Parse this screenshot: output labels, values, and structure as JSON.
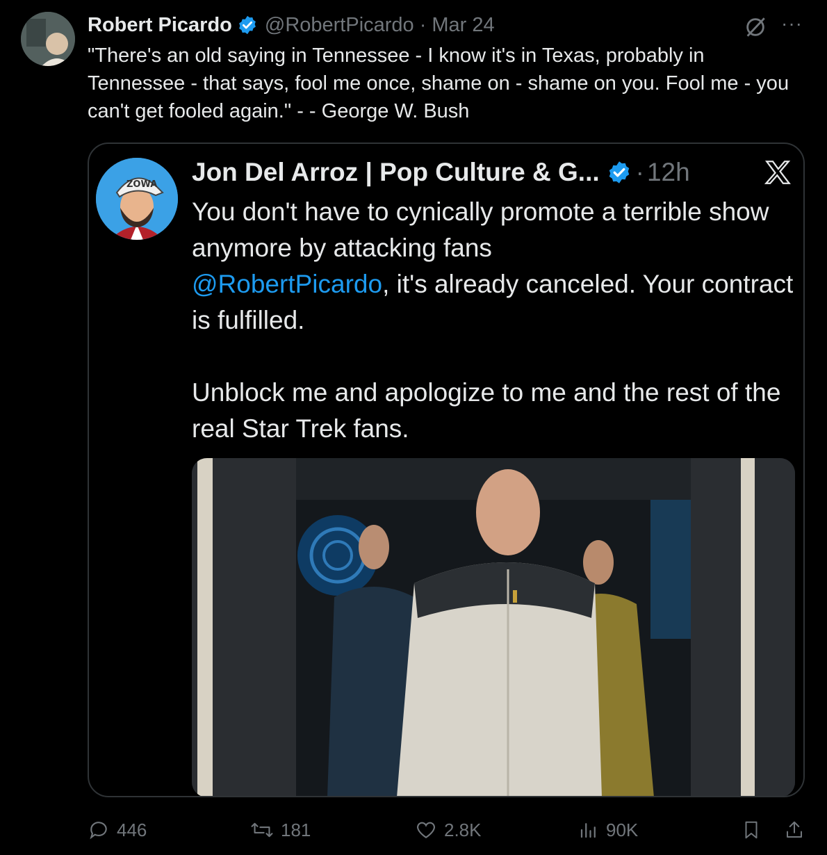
{
  "tweet": {
    "author_name": "Robert Picardo",
    "handle": "@RobertPicardo",
    "separator": "·",
    "date": "Mar 24",
    "more": "···",
    "text": "\"There's an old saying in Tennessee - I know it's in Texas, probably in Tennessee - that says, fool me once, shame on - shame on you. Fool me - you can't get fooled again.\" - - George W. Bush"
  },
  "quote": {
    "author_name": "Jon Del Arroz | Pop Culture & G...",
    "separator": "·",
    "time": "12h",
    "text_line1": "You don't have to cynically promote a terrible show anymore by attacking fans",
    "mention": "@RobertPicardo",
    "text_line2": ", it's already canceled. Your contract is fulfilled.",
    "text_para2": "Unblock me and apologize to me and the rest of the real Star Trek fans.",
    "avatar_hat_text": "ZOWA"
  },
  "actions": {
    "replies": "446",
    "reposts": "181",
    "likes": "2.8K",
    "views": "90K"
  },
  "icons": [
    "verified-icon",
    "grok-icon",
    "more-icon",
    "x-logo-icon",
    "reply-icon",
    "repost-icon",
    "like-icon",
    "views-icon",
    "bookmark-icon",
    "share-icon"
  ],
  "colors": {
    "background": "#000000",
    "text": "#e7e9ea",
    "muted": "#71767b",
    "accent": "#1d9bf0",
    "border": "#2f3336"
  }
}
